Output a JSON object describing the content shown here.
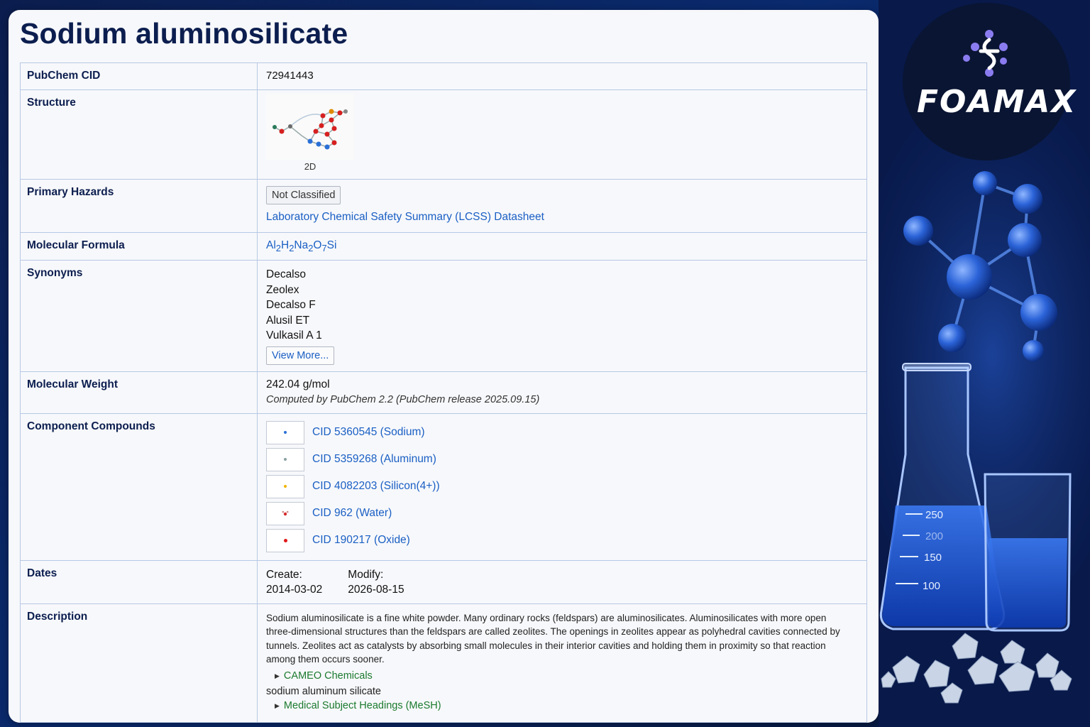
{
  "title": "Sodium aluminosilicate",
  "rows": {
    "cid": {
      "label": "PubChem CID",
      "value": "72941443"
    },
    "structure": {
      "label": "Structure",
      "caption": "2D"
    },
    "hazards": {
      "label": "Primary Hazards",
      "badge": "Not Classified",
      "link": "Laboratory Chemical Safety Summary (LCSS) Datasheet"
    },
    "formula": {
      "label": "Molecular Formula",
      "parts": [
        "Al",
        "2",
        "H",
        "2",
        "Na",
        "2",
        "O",
        "7",
        "Si"
      ]
    },
    "synonyms": {
      "label": "Synonyms",
      "items": [
        "Decalso",
        "Zeolex",
        "Decalso F",
        "Alusil ET",
        "Vulkasil A 1"
      ],
      "more": "View More..."
    },
    "weight": {
      "label": "Molecular Weight",
      "value": "242.04 g/mol",
      "note": "Computed by PubChem 2.2 (PubChem release 2025.09.15)"
    },
    "components": {
      "label": "Component Compounds",
      "items": [
        {
          "text": "CID 5360545 (Sodium)",
          "color": "#2a6fd6"
        },
        {
          "text": "CID 5359268 (Aluminum)",
          "color": "#8aa0a0"
        },
        {
          "text": "CID 4082203 (Silicon(4+))",
          "color": "#f0b400"
        },
        {
          "text": "CID 962 (Water)",
          "color": "#d42a2a"
        },
        {
          "text": "CID 190217 (Oxide)",
          "color": "#e01818"
        }
      ]
    },
    "dates": {
      "label": "Dates",
      "create_label": "Create:",
      "create": "2014-03-02",
      "modify_label": "Modify:",
      "modify": "2026-08-15"
    },
    "description": {
      "label": "Description",
      "text": "Sodium aluminosilicate is a fine white powder. Many ordinary rocks (feldspars) are aluminosilicates. Aluminosilicates with more open three-dimensional structures than the feldspars are called zeolites. The openings in zeolites appear as polyhedral cavities connected by tunnels. Zeolites act as catalysts by absorbing small molecules in their interior cavities and holding them in proximity so that reaction among them occurs sooner.",
      "source1": "CAMEO Chemicals",
      "text2": "sodium aluminum silicate",
      "source2": "Medical Subject Headings (MeSH)"
    }
  },
  "brand": {
    "name": "Foamax"
  },
  "beaker_marks": [
    "250",
    "200",
    "150",
    "100"
  ],
  "colors": {
    "title": "#0c1e4f",
    "link": "#1a5fc4",
    "source": "#1b7a2e",
    "border": "#7d9fd4"
  }
}
